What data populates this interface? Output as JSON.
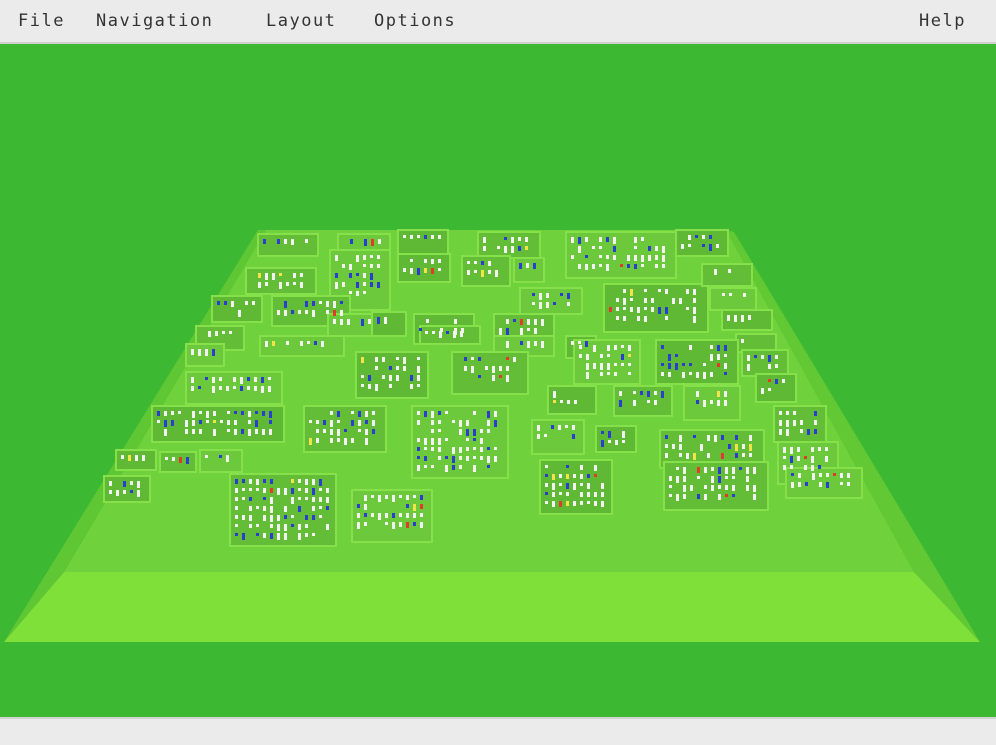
{
  "menubar": {
    "file": "File",
    "navigation": "Navigation",
    "layout": "Layout",
    "options": "Options",
    "help": "Help"
  },
  "colors": {
    "background": "#3cb832",
    "plane_top": "#6fd23c",
    "plane_front": "#7fe03a",
    "plane_side": "#62c834",
    "district": "#66c239",
    "building_white": "#f2f2f2",
    "building_blue": "#2a3fd0",
    "building_red": "#e23b2a",
    "building_yellow": "#f3e34a",
    "menubar_bg": "#ebebeb",
    "statusbar_bg": "#ebebeb"
  },
  "statusbar": {
    "text": ""
  }
}
